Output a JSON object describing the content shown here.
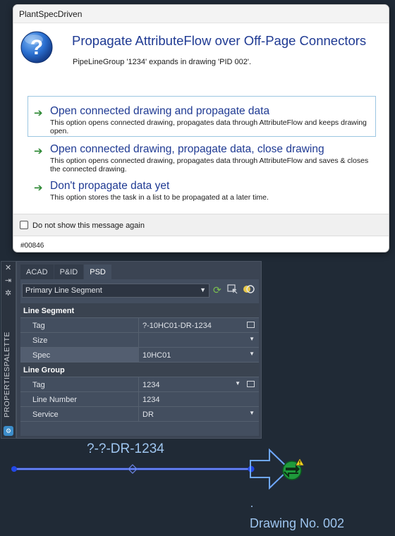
{
  "dialog": {
    "window_title": "PlantSpecDriven",
    "heading": "Propagate AttributeFlow over Off-Page Connectors",
    "subtext": "PipeLineGroup '1234' expands in drawing 'PID 002'.",
    "options": [
      {
        "title": "Open connected drawing and propagate data",
        "description": "This option opens connected drawing, propagates data through AttributeFlow and keeps drawing open."
      },
      {
        "title": "Open connected drawing, propagate data, close drawing",
        "description": "This option opens connected drawing, propagates data through AttributeFlow and saves & closes the connected drawing."
      },
      {
        "title": "Don't propagate data yet",
        "description": "This option stores the task in a list to be propagated at a later time."
      }
    ],
    "checkbox_label": "Do not show this message again",
    "checkbox_checked": false,
    "message_code": "#00846"
  },
  "palette": {
    "vertical_label": "PROPERTIESPALETTE",
    "tabs": [
      "ACAD",
      "P&ID",
      "PSD"
    ],
    "active_tab": "PSD",
    "selected_object": "Primary Line Segment",
    "groups": [
      {
        "name": "Line Segment",
        "rows": [
          {
            "key": "Tag",
            "value": "?-10HC01-DR-1234"
          },
          {
            "key": "Size",
            "value": ""
          },
          {
            "key": "Spec",
            "value": "10HC01"
          }
        ]
      },
      {
        "name": "Line Group",
        "rows": [
          {
            "key": "Tag",
            "value": "1234"
          },
          {
            "key": "Line Number",
            "value": "1234"
          },
          {
            "key": "Service",
            "value": "DR"
          }
        ]
      }
    ]
  },
  "canvas": {
    "line_tag": "?-?-DR-1234",
    "drawing_label": "Drawing No. 002"
  },
  "colors": {
    "canvas_bg": "#202a36",
    "pipe_line": "#3a5cf0",
    "connector": "#6fa8ff",
    "heading": "#1f3a93",
    "arrow_green": "#2f8a36"
  }
}
